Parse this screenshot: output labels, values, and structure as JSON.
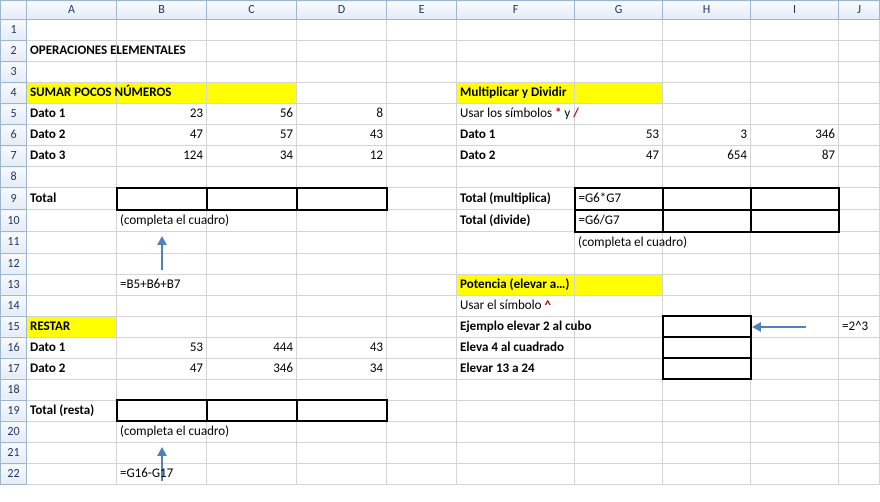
{
  "columns": [
    "",
    "A",
    "B",
    "C",
    "D",
    "E",
    "F",
    "G",
    "H",
    "I",
    "J"
  ],
  "rows": [
    "1",
    "2",
    "3",
    "4",
    "5",
    "6",
    "7",
    "8",
    "9",
    "10",
    "11",
    "12",
    "13",
    "14",
    "15",
    "16",
    "17",
    "18",
    "19",
    "20",
    "21",
    "22"
  ],
  "cells": {
    "A2": "OPERACIONES ELEMENTALES",
    "A4": "SUMAR POCOS NÚMEROS",
    "A5": "Dato 1",
    "B5": "23",
    "C5": "56",
    "D5": "8",
    "A6": "Dato 2",
    "B6": "47",
    "C6": "57",
    "D6": "43",
    "A7": "Dato 3",
    "B7": "124",
    "C7": "34",
    "D7": "12",
    "A9": "Total",
    "B10": "(completa el cuadro)",
    "B13": "=B5+B6+B7",
    "A15": "RESTAR",
    "A16": "Dato 1",
    "B16": "53",
    "C16": "444",
    "D16": "43",
    "A17": "Dato 2",
    "B17": "47",
    "C17": "346",
    "D17": "34",
    "A19": "Total (resta)",
    "B20": "(completa el cuadro)",
    "B22": "=G16-G17",
    "F4": "Multiplicar y Dividir",
    "F5_pre": "Usar los símbolos ",
    "F5_star": "*",
    "F5_mid": " y ",
    "F5_slash": "/",
    "F6": "Dato 1",
    "G6": "53",
    "H6": "3",
    "I6": "346",
    "F7": "Dato 2",
    "G7": "47",
    "H7": "654",
    "I7": "87",
    "F9": "Total (multiplica)",
    "G9": "=G6*G7",
    "F10": "Total (divide)",
    "G10": "=G6/G7",
    "G11": "(completa el cuadro)",
    "F13": "Potencia (elevar a…)",
    "F14_pre": "Usar el símbolo ",
    "F14_sym": "^",
    "F15": "Ejemplo elevar 2 al cubo",
    "F16": "Eleva 4 al cuadrado",
    "F17": "Elevar 13 a 24",
    "J15": "=2^3"
  },
  "colWidths": {
    "_rh": 26,
    "A": 90,
    "B": 90,
    "C": 90,
    "D": 90,
    "E": 70,
    "F": 118,
    "G": 88,
    "H": 88,
    "I": 88,
    "J": 41
  }
}
